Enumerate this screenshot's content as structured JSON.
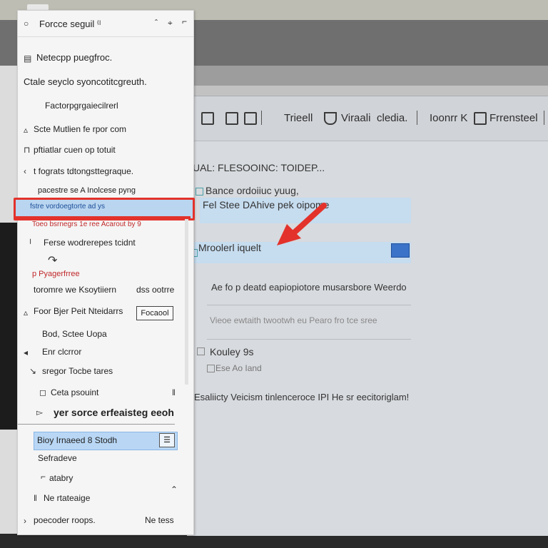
{
  "panel": {
    "title": "Forcce seguil ⁽ˡ",
    "header_icons": [
      "chevron-icon",
      "pin-icon",
      "resize-icon"
    ],
    "rows": [
      "Netecpp puegfroc.",
      "Ctale seyclo syoncotitcgreuth.",
      "Factorpgrgaiecilrerl",
      "Scte Mutlien fe rpor com",
      "pftiatlar cuen op totuit",
      "t fograts tdtongsttegraque.",
      "pacestre se A  Inolcese pyng",
      "fstre  vordoegtorte ad  ys",
      "Toeo  bsrnegrs  1e  ree  Acarout by  9",
      "Ferse wodrerepes tcidnt",
      "p  Pyagerfrree",
      "toromre  we  Ksoytiiern",
      "dss ootrre",
      "Foor Bjer  Peit Nteidarrs",
      "Focaool",
      "Bod, Sctee Uopa",
      "Enr  clcrror",
      "sregor Tocbe tares",
      "Ceta psouint",
      "yer sorce erfeaisteg eeoh",
      "Bioy  Irnaeed  8 Stodh",
      "Sefradeve",
      "atabry",
      "Ne rtateaige",
      "poecoder roops.",
      "Ne tess"
    ]
  },
  "document": {
    "toolbar": [
      "Trieell",
      "Viraali",
      "cledia.",
      "Ioonrr  K",
      "Frrensteel"
    ],
    "heading": "UAL: FLESOOINC:   TOIDEP...",
    "lines": [
      "Bance ordoiiuc yuug,",
      "Fel Stee DAhive pek oipome",
      "Mroolerl iquelt",
      "Ae fo p  deatd eapiopiotore  musarsbore  Weerdo",
      "Vieoe  ewtaith  twootwh  eu  Pearo  fro  tce  sree",
      "Kouley  9s",
      "Ese  Ao  Iand",
      "Esaliicty  Veicism  tinlenceroce  IPI  He  sr  eecitoriglam!"
    ]
  },
  "colors": {
    "annotation_red": "#e3322b",
    "selection_blue": "#b9d7f5"
  }
}
